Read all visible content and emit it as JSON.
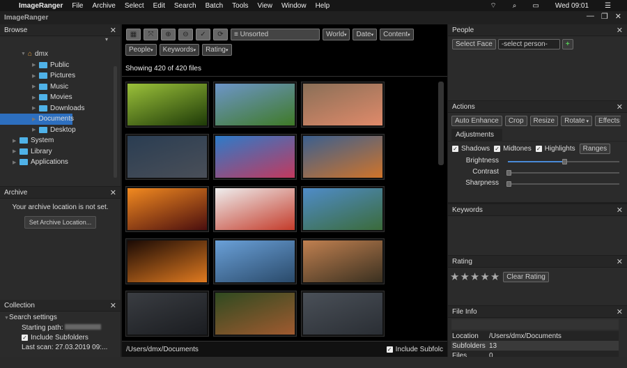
{
  "menubar": {
    "app": "ImageRanger",
    "items": [
      "File",
      "Archive",
      "Select",
      "Edit",
      "Search",
      "Batch",
      "Tools",
      "View",
      "Window",
      "Help"
    ],
    "clock": "Wed 09:01"
  },
  "window": {
    "title": "ImageRanger"
  },
  "browse": {
    "title": "Browse",
    "tree": [
      {
        "label": "dmx",
        "level": 0,
        "icon": "home-icon",
        "expanded": true
      },
      {
        "label": "Public",
        "level": 1
      },
      {
        "label": "Pictures",
        "level": 1
      },
      {
        "label": "Music",
        "level": 1
      },
      {
        "label": "Movies",
        "level": 1
      },
      {
        "label": "Downloads",
        "level": 1
      },
      {
        "label": "Documents",
        "level": 1,
        "selected": true
      },
      {
        "label": "Desktop",
        "level": 1
      },
      {
        "label": "System",
        "level": -1
      },
      {
        "label": "Library",
        "level": -1
      },
      {
        "label": "Applications",
        "level": -1
      }
    ]
  },
  "archive": {
    "title": "Archive",
    "message": "Your archive location is not set.",
    "button": "Set Archive Location..."
  },
  "collection": {
    "title": "Collection",
    "search_settings": "Search settings",
    "starting_path": "Starting path:",
    "include_subfolders": "Include Subfolders",
    "last_scan": "Last scan: 27.03.2019 09:..."
  },
  "toolbar": {
    "sort": "Unsorted",
    "filters": [
      "World",
      "Date",
      "Content"
    ],
    "filters2": [
      "People",
      "Keywords",
      "Rating"
    ]
  },
  "status": {
    "showing": "Showing 420 of 420 files",
    "path": "/Users/dmx/Documents",
    "include_subfolders": "Include Subfolc"
  },
  "thumbs": [
    [
      "#9bc13a",
      "#1e3a08"
    ],
    [
      "#6d95c9",
      "#3f7a27"
    ],
    [
      "#8a6f57",
      "#e08a6a"
    ],
    [
      "#2a3d52",
      "#4a4f58"
    ],
    [
      "#2d7bc9",
      "#c2395e"
    ],
    [
      "#3a5f8f",
      "#d0742a"
    ],
    [
      "#f28a20",
      "#4a0e0e"
    ],
    [
      "#eeeeee",
      "#c43b2a"
    ],
    [
      "#4f8cc9",
      "#3b6b3a"
    ],
    [
      "#1a0a05",
      "#e07a20"
    ],
    [
      "#6aa0d8",
      "#2a4a6a"
    ],
    [
      "#c08050",
      "#3a3020"
    ],
    [
      "#3a3d42",
      "#1a1c20"
    ],
    [
      "#2f4a20",
      "#a05a30"
    ],
    [
      "#4a5058",
      "#2a2e34"
    ]
  ],
  "people": {
    "title": "People",
    "select_face": "Select Face",
    "person": "-select person-",
    "add": "+"
  },
  "actions": {
    "title": "Actions",
    "buttons": [
      "Auto Enhance",
      "Crop",
      "Resize",
      "Rotate",
      "Effects"
    ],
    "tab": "Adjustments",
    "checks": [
      "Shadows",
      "Midtones",
      "Highlights"
    ],
    "ranges": "Ranges",
    "sliders": [
      {
        "label": "Brightness",
        "value": 0.5
      },
      {
        "label": "Contrast",
        "value": 0
      },
      {
        "label": "Sharpness",
        "value": 0
      }
    ]
  },
  "keywords": {
    "title": "Keywords"
  },
  "rating": {
    "title": "Rating",
    "value": 0,
    "max": 5,
    "clear": "Clear Rating"
  },
  "fileinfo": {
    "title": "File Info",
    "rows": [
      {
        "k": "Location",
        "v": "/Users/dmx/Documents"
      },
      {
        "k": "Subfolders",
        "v": "13"
      },
      {
        "k": "Files",
        "v": "0"
      }
    ]
  }
}
